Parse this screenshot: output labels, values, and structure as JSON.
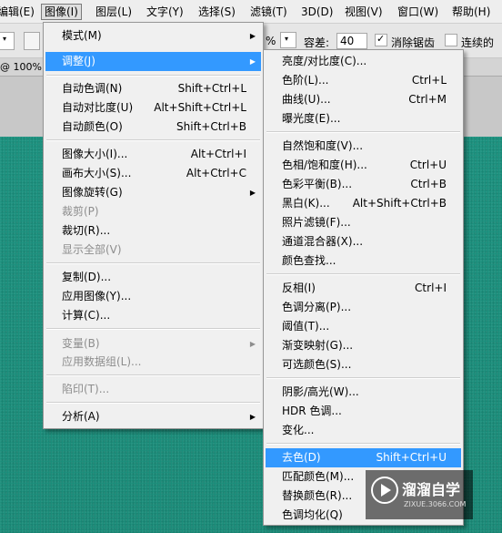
{
  "menubar": {
    "items": [
      "编辑(E)",
      "图像(I)",
      "图层(L)",
      "文字(Y)",
      "选择(S)",
      "滤镜(T)",
      "3D(D)",
      "视图(V)",
      "窗口(W)",
      "帮助(H)"
    ]
  },
  "options_bar": {
    "percent_suffix": "%",
    "tolerance_label": "容差:",
    "tolerance_value": "40",
    "antialias_label": "消除锯齿",
    "contiguous_label": "连续的"
  },
  "doc_tab": {
    "zoom": "@ 100%"
  },
  "image_menu": {
    "items": [
      {
        "label": "模式(M)",
        "submenu": true
      },
      {
        "label": "调整(J)",
        "submenu": true,
        "highlighted": true
      },
      {
        "label": "自动色调(N)",
        "shortcut": "Shift+Ctrl+L"
      },
      {
        "label": "自动对比度(U)",
        "shortcut": "Alt+Shift+Ctrl+L"
      },
      {
        "label": "自动颜色(O)",
        "shortcut": "Shift+Ctrl+B"
      },
      {
        "label": "图像大小(I)...",
        "shortcut": "Alt+Ctrl+I"
      },
      {
        "label": "画布大小(S)...",
        "shortcut": "Alt+Ctrl+C"
      },
      {
        "label": "图像旋转(G)",
        "submenu": true
      },
      {
        "label": "裁剪(P)",
        "disabled": true
      },
      {
        "label": "裁切(R)..."
      },
      {
        "label": "显示全部(V)",
        "disabled": true
      },
      {
        "label": "复制(D)..."
      },
      {
        "label": "应用图像(Y)..."
      },
      {
        "label": "计算(C)..."
      },
      {
        "label": "变量(B)",
        "submenu": true,
        "disabled": true
      },
      {
        "label": "应用数据组(L)...",
        "disabled": true
      },
      {
        "label": "陷印(T)...",
        "disabled": true
      },
      {
        "label": "分析(A)",
        "submenu": true
      }
    ]
  },
  "adjust_menu": {
    "items": [
      {
        "label": "亮度/对比度(C)..."
      },
      {
        "label": "色阶(L)...",
        "shortcut": "Ctrl+L"
      },
      {
        "label": "曲线(U)...",
        "shortcut": "Ctrl+M"
      },
      {
        "label": "曝光度(E)..."
      },
      {
        "label": "自然饱和度(V)..."
      },
      {
        "label": "色相/饱和度(H)...",
        "shortcut": "Ctrl+U"
      },
      {
        "label": "色彩平衡(B)...",
        "shortcut": "Ctrl+B"
      },
      {
        "label": "黑白(K)...",
        "shortcut": "Alt+Shift+Ctrl+B"
      },
      {
        "label": "照片滤镜(F)..."
      },
      {
        "label": "通道混合器(X)..."
      },
      {
        "label": "颜色查找..."
      },
      {
        "label": "反相(I)",
        "shortcut": "Ctrl+I"
      },
      {
        "label": "色调分离(P)..."
      },
      {
        "label": "阈值(T)..."
      },
      {
        "label": "渐变映射(G)..."
      },
      {
        "label": "可选颜色(S)..."
      },
      {
        "label": "阴影/高光(W)..."
      },
      {
        "label": "HDR 色调..."
      },
      {
        "label": "变化..."
      },
      {
        "label": "去色(D)",
        "shortcut": "Shift+Ctrl+U",
        "highlighted": true
      },
      {
        "label": "匹配颜色(M)..."
      },
      {
        "label": "替换颜色(R)..."
      },
      {
        "label": "色调均化(Q)"
      }
    ]
  },
  "watermark": {
    "title": "溜溜自学",
    "subtitle": "ZIXUE.3066.COM"
  },
  "colors": {
    "highlight": "#3399ff",
    "canvas": "#1a8c79",
    "menu_bg": "#f0f0f0"
  }
}
